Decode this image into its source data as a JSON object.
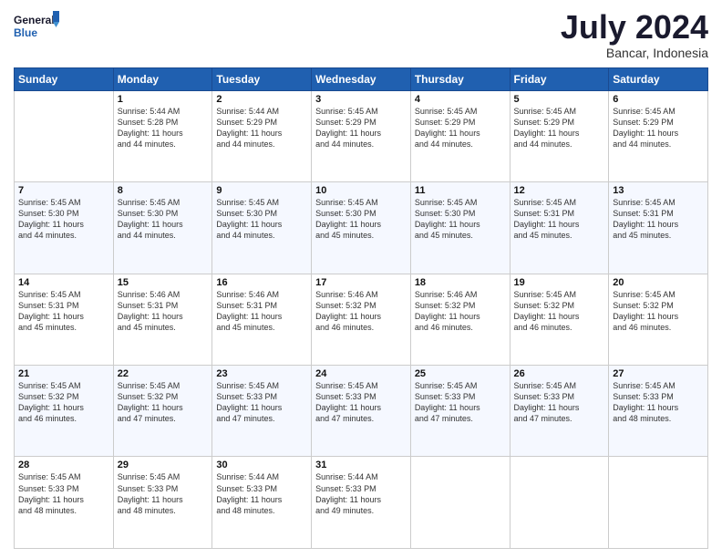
{
  "logo": {
    "text_general": "General",
    "text_blue": "Blue"
  },
  "header": {
    "month": "July 2024",
    "location": "Bancar, Indonesia"
  },
  "days_of_week": [
    "Sunday",
    "Monday",
    "Tuesday",
    "Wednesday",
    "Thursday",
    "Friday",
    "Saturday"
  ],
  "weeks": [
    {
      "row_class": "week-row-1",
      "days": [
        {
          "num": "",
          "info": ""
        },
        {
          "num": "1",
          "info": "Sunrise: 5:44 AM\nSunset: 5:28 PM\nDaylight: 11 hours\nand 44 minutes."
        },
        {
          "num": "2",
          "info": "Sunrise: 5:44 AM\nSunset: 5:29 PM\nDaylight: 11 hours\nand 44 minutes."
        },
        {
          "num": "3",
          "info": "Sunrise: 5:45 AM\nSunset: 5:29 PM\nDaylight: 11 hours\nand 44 minutes."
        },
        {
          "num": "4",
          "info": "Sunrise: 5:45 AM\nSunset: 5:29 PM\nDaylight: 11 hours\nand 44 minutes."
        },
        {
          "num": "5",
          "info": "Sunrise: 5:45 AM\nSunset: 5:29 PM\nDaylight: 11 hours\nand 44 minutes."
        },
        {
          "num": "6",
          "info": "Sunrise: 5:45 AM\nSunset: 5:29 PM\nDaylight: 11 hours\nand 44 minutes."
        }
      ]
    },
    {
      "row_class": "week-row-2",
      "days": [
        {
          "num": "7",
          "info": "Sunrise: 5:45 AM\nSunset: 5:30 PM\nDaylight: 11 hours\nand 44 minutes."
        },
        {
          "num": "8",
          "info": "Sunrise: 5:45 AM\nSunset: 5:30 PM\nDaylight: 11 hours\nand 44 minutes."
        },
        {
          "num": "9",
          "info": "Sunrise: 5:45 AM\nSunset: 5:30 PM\nDaylight: 11 hours\nand 44 minutes."
        },
        {
          "num": "10",
          "info": "Sunrise: 5:45 AM\nSunset: 5:30 PM\nDaylight: 11 hours\nand 45 minutes."
        },
        {
          "num": "11",
          "info": "Sunrise: 5:45 AM\nSunset: 5:30 PM\nDaylight: 11 hours\nand 45 minutes."
        },
        {
          "num": "12",
          "info": "Sunrise: 5:45 AM\nSunset: 5:31 PM\nDaylight: 11 hours\nand 45 minutes."
        },
        {
          "num": "13",
          "info": "Sunrise: 5:45 AM\nSunset: 5:31 PM\nDaylight: 11 hours\nand 45 minutes."
        }
      ]
    },
    {
      "row_class": "week-row-3",
      "days": [
        {
          "num": "14",
          "info": "Sunrise: 5:45 AM\nSunset: 5:31 PM\nDaylight: 11 hours\nand 45 minutes."
        },
        {
          "num": "15",
          "info": "Sunrise: 5:46 AM\nSunset: 5:31 PM\nDaylight: 11 hours\nand 45 minutes."
        },
        {
          "num": "16",
          "info": "Sunrise: 5:46 AM\nSunset: 5:31 PM\nDaylight: 11 hours\nand 45 minutes."
        },
        {
          "num": "17",
          "info": "Sunrise: 5:46 AM\nSunset: 5:32 PM\nDaylight: 11 hours\nand 46 minutes."
        },
        {
          "num": "18",
          "info": "Sunrise: 5:46 AM\nSunset: 5:32 PM\nDaylight: 11 hours\nand 46 minutes."
        },
        {
          "num": "19",
          "info": "Sunrise: 5:45 AM\nSunset: 5:32 PM\nDaylight: 11 hours\nand 46 minutes."
        },
        {
          "num": "20",
          "info": "Sunrise: 5:45 AM\nSunset: 5:32 PM\nDaylight: 11 hours\nand 46 minutes."
        }
      ]
    },
    {
      "row_class": "week-row-4",
      "days": [
        {
          "num": "21",
          "info": "Sunrise: 5:45 AM\nSunset: 5:32 PM\nDaylight: 11 hours\nand 46 minutes."
        },
        {
          "num": "22",
          "info": "Sunrise: 5:45 AM\nSunset: 5:32 PM\nDaylight: 11 hours\nand 47 minutes."
        },
        {
          "num": "23",
          "info": "Sunrise: 5:45 AM\nSunset: 5:33 PM\nDaylight: 11 hours\nand 47 minutes."
        },
        {
          "num": "24",
          "info": "Sunrise: 5:45 AM\nSunset: 5:33 PM\nDaylight: 11 hours\nand 47 minutes."
        },
        {
          "num": "25",
          "info": "Sunrise: 5:45 AM\nSunset: 5:33 PM\nDaylight: 11 hours\nand 47 minutes."
        },
        {
          "num": "26",
          "info": "Sunrise: 5:45 AM\nSunset: 5:33 PM\nDaylight: 11 hours\nand 47 minutes."
        },
        {
          "num": "27",
          "info": "Sunrise: 5:45 AM\nSunset: 5:33 PM\nDaylight: 11 hours\nand 48 minutes."
        }
      ]
    },
    {
      "row_class": "week-row-5",
      "days": [
        {
          "num": "28",
          "info": "Sunrise: 5:45 AM\nSunset: 5:33 PM\nDaylight: 11 hours\nand 48 minutes."
        },
        {
          "num": "29",
          "info": "Sunrise: 5:45 AM\nSunset: 5:33 PM\nDaylight: 11 hours\nand 48 minutes."
        },
        {
          "num": "30",
          "info": "Sunrise: 5:44 AM\nSunset: 5:33 PM\nDaylight: 11 hours\nand 48 minutes."
        },
        {
          "num": "31",
          "info": "Sunrise: 5:44 AM\nSunset: 5:33 PM\nDaylight: 11 hours\nand 49 minutes."
        },
        {
          "num": "",
          "info": ""
        },
        {
          "num": "",
          "info": ""
        },
        {
          "num": "",
          "info": ""
        }
      ]
    }
  ]
}
